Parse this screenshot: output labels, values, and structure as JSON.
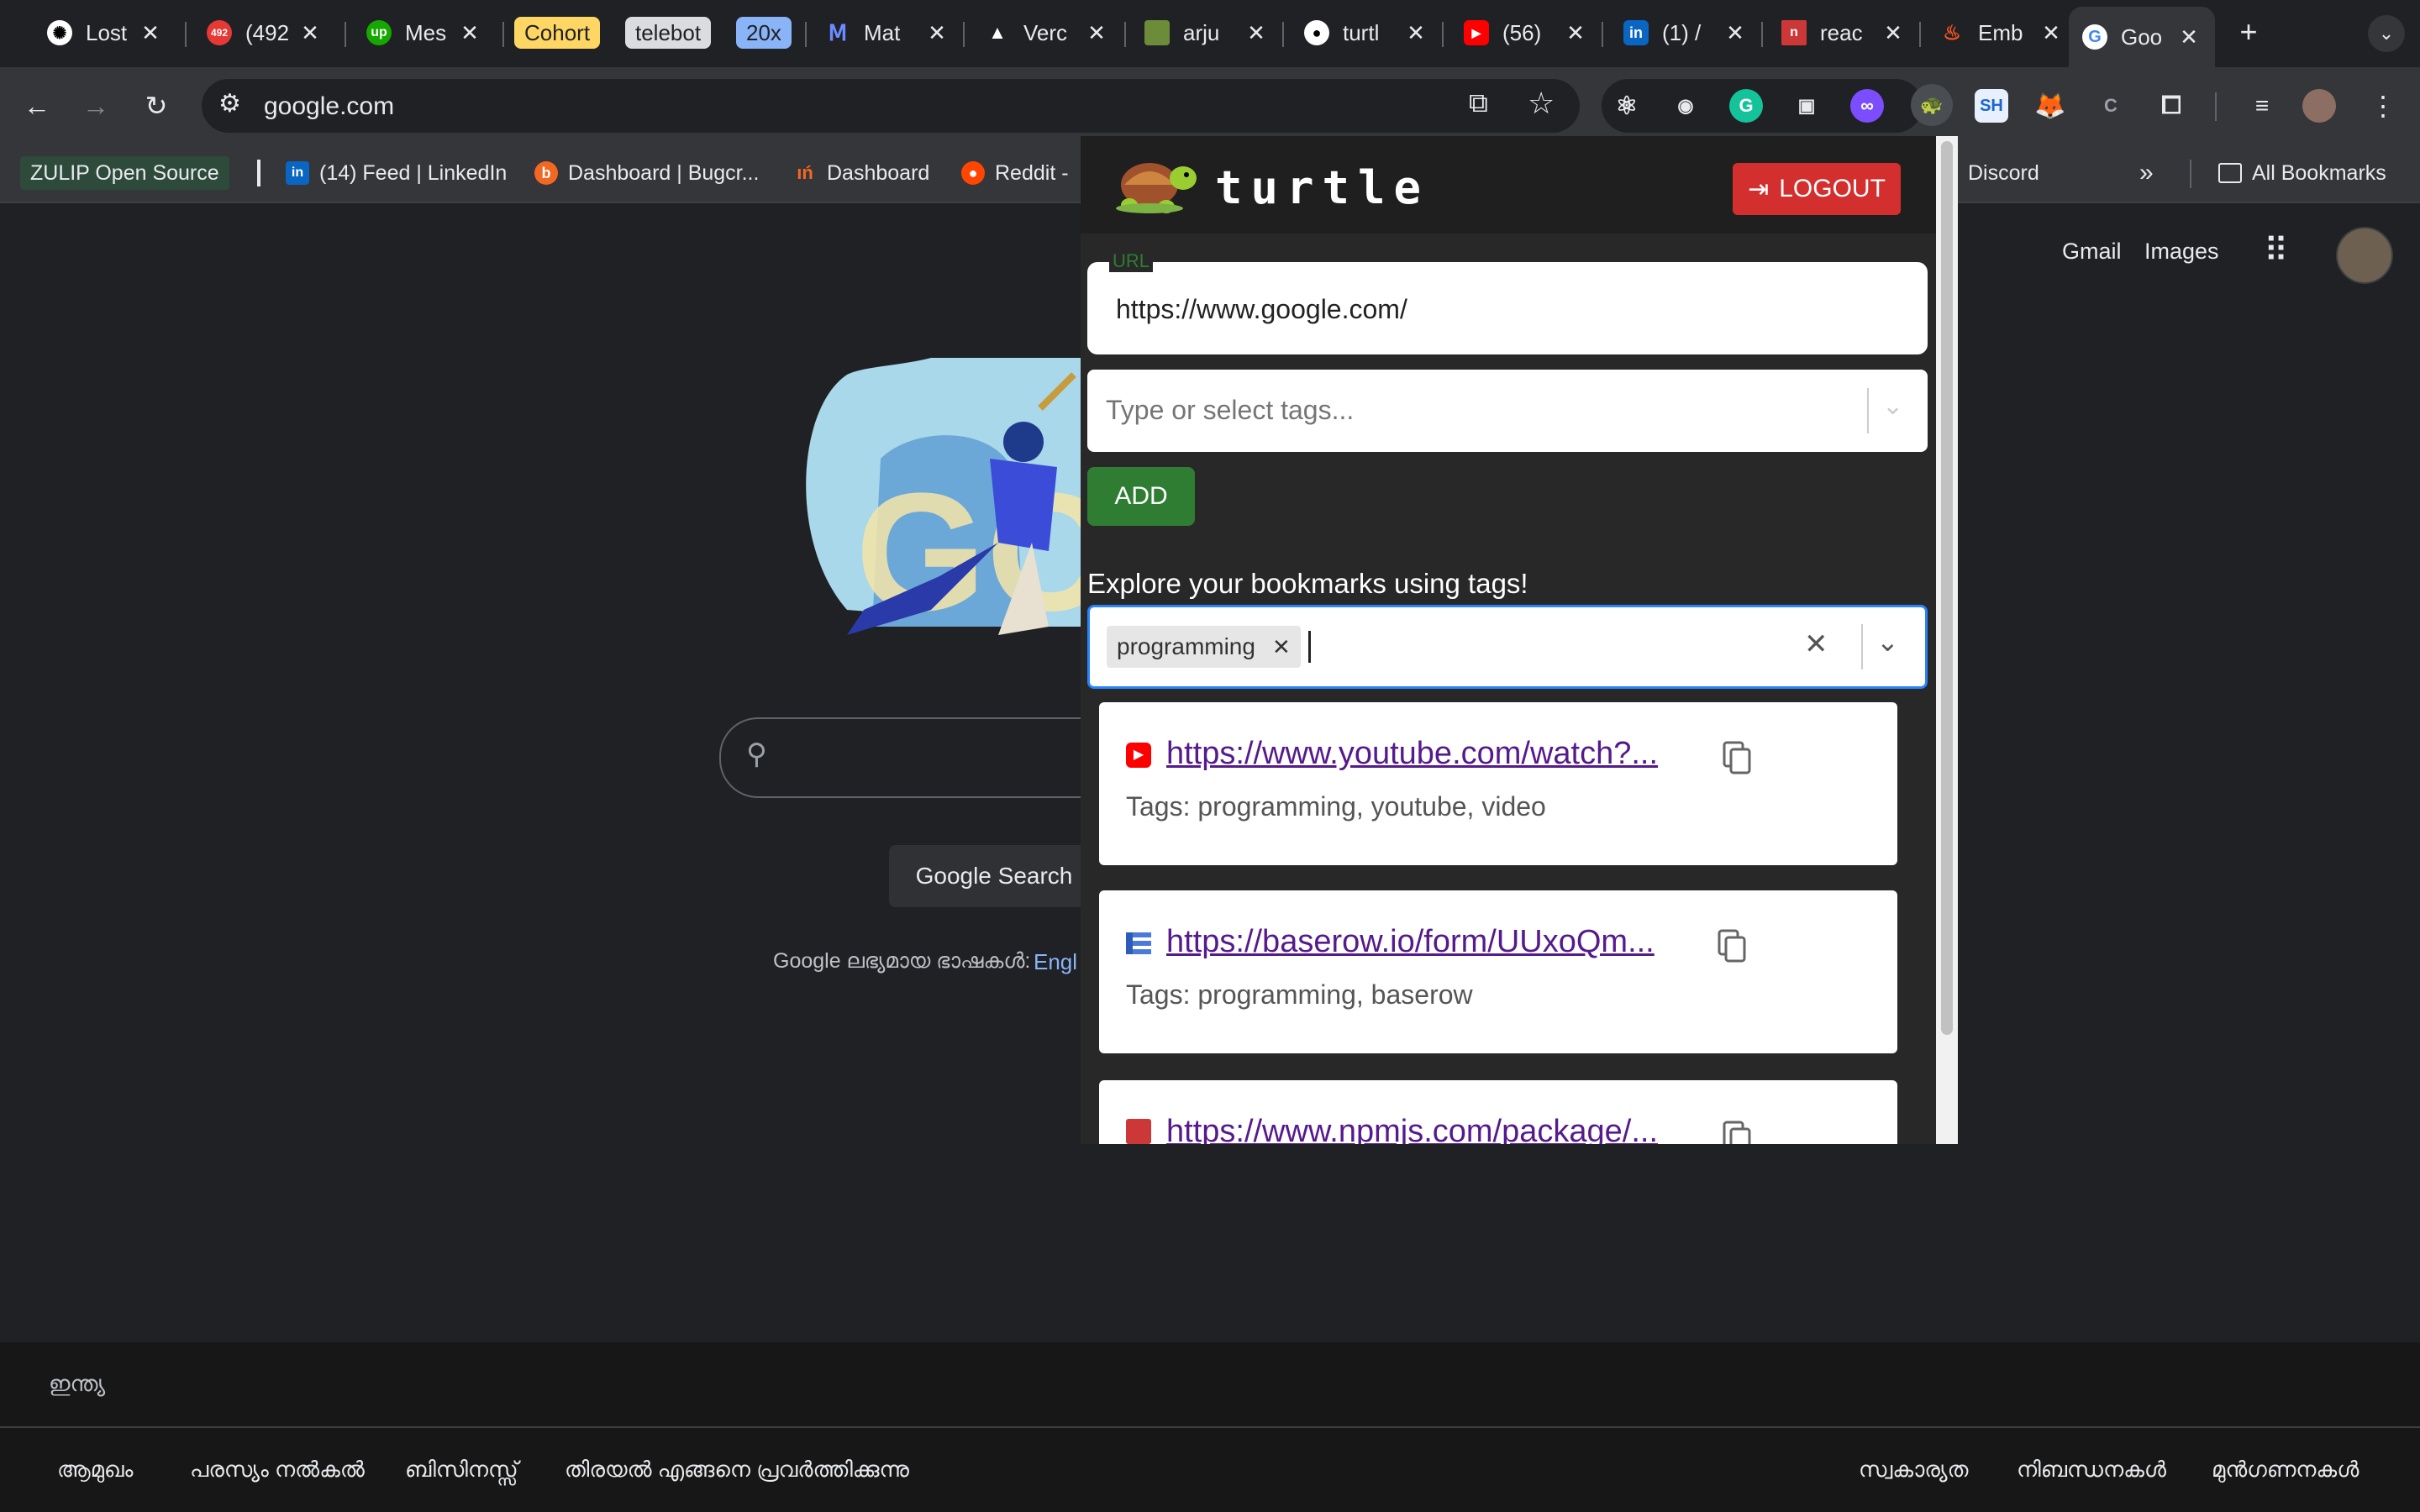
{
  "tabs": [
    {
      "title": "Lost",
      "fav": "openai-icon"
    },
    {
      "title": "(492",
      "fav": "badge-icon"
    },
    {
      "title": "Mes",
      "fav": "upwork-icon"
    },
    {
      "title": "Cohort",
      "type": "group-label"
    },
    {
      "title": "telebot",
      "type": "group-label"
    },
    {
      "title": "20x",
      "type": "group-label"
    },
    {
      "title": "Mat",
      "fav": "material-icon"
    },
    {
      "title": "Verc",
      "fav": "vercel-icon"
    },
    {
      "title": "arju",
      "fav": "minecraft-icon"
    },
    {
      "title": "turtl",
      "fav": "github-icon"
    },
    {
      "title": "(56)",
      "fav": "youtube-icon"
    },
    {
      "title": "(1) /",
      "fav": "linkedin-icon"
    },
    {
      "title": "reac",
      "fav": "npm-icon"
    },
    {
      "title": "Emb",
      "fav": "embed-icon"
    },
    {
      "title": "Goo",
      "fav": "google-icon",
      "active": true
    }
  ],
  "toolbar": {
    "url": "google.com"
  },
  "bookmarks": [
    {
      "label": "ZULIP Open Source"
    },
    {
      "label": "(14) Feed | LinkedIn"
    },
    {
      "label": "Dashboard | Bugcr..."
    },
    {
      "label": "Dashboard"
    },
    {
      "label": "Reddit -"
    },
    {
      "label": "Discord"
    },
    {
      "label": "All Bookmarks"
    }
  ],
  "google": {
    "gmail": "Gmail",
    "images": "Images",
    "search_button": "Google Search",
    "offered_in": "Google ലഭ്യമായ ഭാഷകൾ:",
    "lang_link": "Engl",
    "country": "ഇന്ത്യ",
    "footer_left": [
      "ആമുഖം",
      "പരസ്യം നൽകൽ",
      "ബിസിനസ്സ്",
      "തിരയൽ എങ്ങനെ പ്രവർത്തിക്കുന്നു"
    ],
    "footer_right": [
      "സ്വകാര്യത",
      "നിബന്ധനകൾ",
      "മുൻഗണനകൾ"
    ]
  },
  "popup": {
    "brand": "turtle",
    "logout": "LOGOUT",
    "url_label": "URL",
    "url_value": "https://www.google.com/",
    "tags_placeholder": "Type or select tags...",
    "add": "ADD",
    "explore": "Explore your bookmarks using tags!",
    "selected_tag": "programming",
    "results": [
      {
        "link": "https://www.youtube.com/watch?...",
        "tags": "Tags: programming, youtube, video",
        "fav": "youtube-icon"
      },
      {
        "link": "https://baserow.io/form/UUxoQm...",
        "tags": "Tags: programming, baserow",
        "fav": "baserow-icon"
      },
      {
        "link": "https://www.npmjs.com/package/...",
        "tags": "",
        "fav": "npm-icon"
      }
    ]
  },
  "colors": {
    "logout": "#d32f2f",
    "add": "#2e7d32",
    "link": "#551a8b",
    "focus": "#2684ff"
  }
}
